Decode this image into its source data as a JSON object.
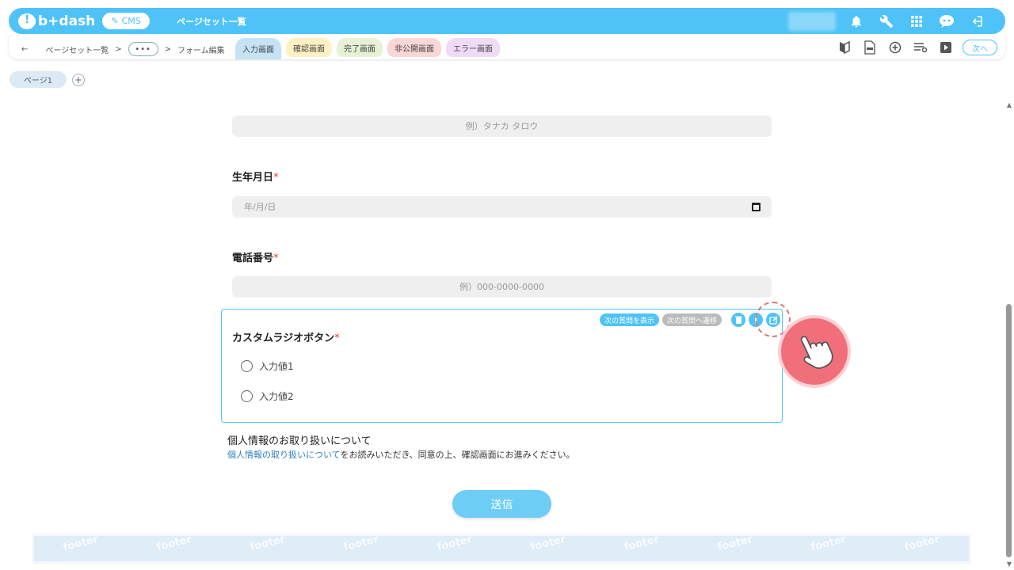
{
  "topbar": {
    "logo_text": "b+dash",
    "cms_label": "CMS",
    "title": "ページセット一覧"
  },
  "subbar": {
    "back_icon": "←",
    "crumb1": "ページセット一覧",
    "sep": ">",
    "dots": "•••",
    "crumb2": "フォーム編集",
    "tabs": [
      "入力画面",
      "確認画面",
      "完了画面",
      "非公開画面",
      "エラー画面"
    ],
    "next_label": "次へ"
  },
  "page_tab": {
    "label": "ページ1",
    "add": "+"
  },
  "form": {
    "name_placeholder": "例）タナカ タロウ",
    "birthday_label": "生年月日",
    "birthday_placeholder": "年/月/日",
    "phone_label": "電話番号",
    "phone_placeholder": "例）000-0000-0000",
    "required_mark": "*",
    "radio": {
      "label": "カスタムラジオボタン",
      "options": [
        "入力値1",
        "入力値2"
      ],
      "show_next_label": "次の質問を表示",
      "goto_next_label": "次の質問へ遷移"
    },
    "privacy_title": "個人情報のお取り扱いについて",
    "privacy_link": "個人情報の取り扱いについて",
    "privacy_rest": "をお読みいただき、同意の上、確認画面にお進みください。",
    "submit_label": "送信"
  },
  "footer": {
    "watermark": "footer"
  },
  "colors": {
    "accent": "#4fc3f7",
    "required": "#e53935",
    "pointer": "#f06f7a"
  }
}
